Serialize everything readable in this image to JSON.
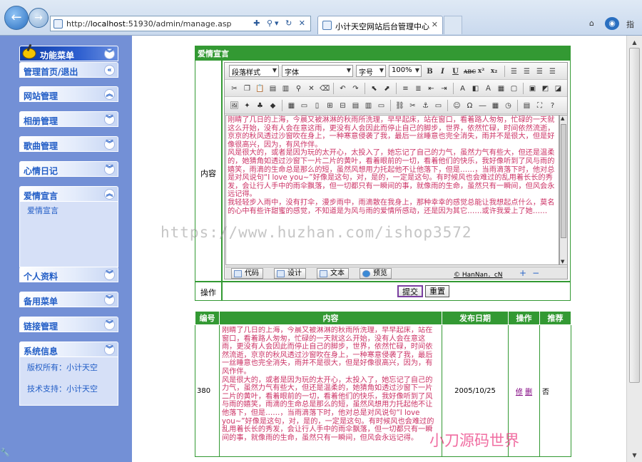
{
  "browser": {
    "back_icon": "arrow-left-icon",
    "forward_icon": "arrow-right-icon",
    "url_prefix": "http://",
    "url_host": "localhost",
    "url_rest": ":51930/admin/manage.asp",
    "tab_title": "小计天空网站后台管理中心",
    "command_label": "指"
  },
  "sidebar": {
    "title": "功能菜单",
    "sections": [
      {
        "label": "管理首页/退出",
        "toggle": "«"
      },
      {
        "label": "网站管理",
        "toggle": "︽"
      },
      {
        "label": "相册管理",
        "toggle": "︾"
      },
      {
        "label": "歌曲管理",
        "toggle": "︾"
      },
      {
        "label": "心情日记",
        "toggle": "︾"
      },
      {
        "label": "爱情宣言",
        "toggle": "︽",
        "items": [
          "爱情宣言"
        ]
      },
      {
        "label": "个人资料",
        "toggle": "︾"
      },
      {
        "label": "备用菜单",
        "toggle": "︾"
      },
      {
        "label": "链接管理",
        "toggle": "︾"
      },
      {
        "label": "系统信息",
        "toggle": "︾",
        "items": [
          "版权所有：小计天空",
          "技术支持：小计天空"
        ]
      }
    ]
  },
  "form": {
    "title": "爱情宣言",
    "content_label": "内容",
    "operation_label": "操作",
    "submit_label": "提交",
    "reset_label": "重置"
  },
  "editor": {
    "style_select": "段落样式",
    "font_select": "字体",
    "size_select": "字号",
    "zoom_select": "100%",
    "format_buttons": [
      "B",
      "I",
      "U",
      "ABC",
      "x²",
      "x₂"
    ],
    "text": [
      "刚睛了几日的上海，今晨又被淋淋的秋雨所洗理，早早起床，站在窗口，看着路人匆匆，忙碌的一天就这么开始，没有人会在意这雨，更没有人会因此而停止自己的脚步，世界，依然忙碌，时间依然流逝，京京的秋风透过沙窗吹在身上，一种寒意侵袭了我，最后一丝睡意也完全消失，雨并不是很大，但是好像很高兴，因为，有风作伴。",
      "风是很大的，或者是因为玩的太开心，太投入了，她忘记了自己的力气，虽然力气有些大，但还是温柔的，她猜角如透过沙窗下一片二片的黄叶，看着眼前的一切，看着他们的快乐，我好像听到了风与雨的嬉笑，雨滴的生命总是那么的短，虽然风想用力托起他不让他落下，但是……，当雨滴落下时，他对总是对风说句“I love you~”好像是这句，对，是的，一定是这句。有时候风也会难过的乱用着长长的秀发，会让行人手中的雨伞飘落，但一切都只有一瞬间的事，就像雨的生命，虽然只有一瞬间，但风会永远记得。",
      "我轻轻步入雨中，没有打伞，漫步雨中，雨滴散在我身上，那种幸幸的感觉总能让我想起点什么，莫名的心中有些许甜蜜的感觉，不知道是为风与雨的爱情所感动，还是因为其它……或许我爱上了她……"
    ],
    "modes": [
      "代码",
      "设计",
      "文本",
      "预览"
    ],
    "credit": "HanNan．cN"
  },
  "list": {
    "headers": [
      "编号",
      "内容",
      "发布日期",
      "操作",
      "推荐"
    ],
    "rows": [
      {
        "id": "380",
        "content": [
          "刚睛了几日的上海，今晨又被淋淋的秋雨所洗理，早早起床，站在窗口，看着路人匆匆，忙碌的一天就这么开始，没有人会在意这雨，更没有人会因此而停止自己的脚步，世界，依然忙碌，时间依然流逝，京京的秋风透过沙窗吹在身上，一种寒意侵袭了我，最后一丝睡意也完全消失，雨并不是很大，但是好像很高兴，因为，有风作伴。",
          "风是很大的，或者是因为玩的太开心，太投入了，她忘记了自己的力气，虽然力气有些大，但还是温柔的，她猜角如透过沙窗下一片二片的黄叶，看着眼前的一切，看着他们的快乐，我好像听到了风与雨的嬉笑，雨滴的生命总是那么的短，虽然风想用力托起他不让他落下，但是……，当雨滴落下时，他对总是对风说句“I love you~”好像是这句，对，是的，一定是这句。有时候风也会难过的乱用着长长的秀发，会让行人手中的雨伞飘落，但一切都只有一瞬间的事，就像雨的生命，虽然只有一瞬间，但风会永远记得。"
        ],
        "date": "2005/10/25",
        "op_edit": "修",
        "op_delete": "删",
        "recommend": "否"
      }
    ]
  },
  "watermark": {
    "main": "https://www.huzhan.com/ishop3572",
    "secondary": "小刀源码世界"
  }
}
